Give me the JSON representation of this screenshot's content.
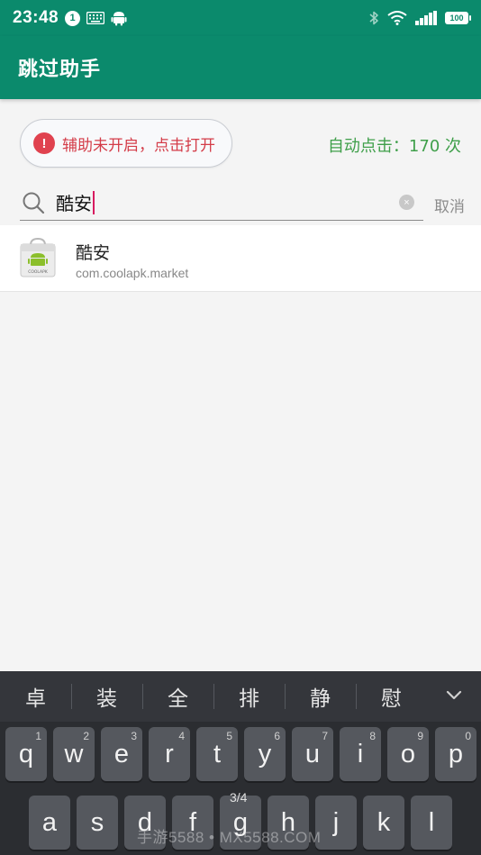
{
  "status_bar": {
    "time": "23:48",
    "notification_count": "1",
    "battery": "100"
  },
  "app_bar": {
    "title": "跳过助手"
  },
  "accessibility": {
    "warning_icon": "!",
    "status_text": "辅助未开启，点击打开",
    "click_count_text": "自动点击：170 次"
  },
  "search": {
    "query": "酷安",
    "clear_icon": "×",
    "cancel_label": "取消"
  },
  "results": [
    {
      "name": "酷安",
      "package": "com.coolapk.market",
      "icon_label": "COOLAPK"
    }
  ],
  "keyboard": {
    "candidates": [
      "卓",
      "装",
      "全",
      "排",
      "静",
      "慰"
    ],
    "row1": [
      {
        "letter": "q",
        "number": "1"
      },
      {
        "letter": "w",
        "number": "2"
      },
      {
        "letter": "e",
        "number": "3"
      },
      {
        "letter": "r",
        "number": "4"
      },
      {
        "letter": "t",
        "number": "5"
      },
      {
        "letter": "y",
        "number": "6"
      },
      {
        "letter": "u",
        "number": "7"
      },
      {
        "letter": "i",
        "number": "8"
      },
      {
        "letter": "o",
        "number": "9"
      },
      {
        "letter": "p",
        "number": "0"
      }
    ],
    "row2": [
      "a",
      "s",
      "d",
      "f",
      "g",
      "h",
      "j",
      "k",
      "l"
    ],
    "page_indicator": "3/4"
  },
  "watermark": "手游5588 • MX5588.COM",
  "colors": {
    "primary": "#0b8a6c",
    "warning": "#e0424f",
    "count_green": "#3f9f4a",
    "caret": "#d81b60"
  },
  "icons": [
    "notification-icon",
    "keyboard-icon",
    "android-icon",
    "bluetooth-icon",
    "wifi-icon",
    "signal-icon",
    "battery-icon",
    "search-icon",
    "clear-icon",
    "chevron-down-icon"
  ]
}
